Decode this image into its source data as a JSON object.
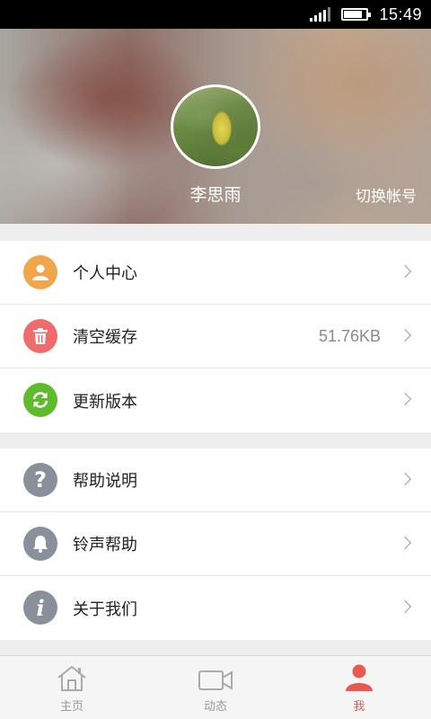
{
  "status_bar": {
    "time": "15:49",
    "signal_icon": "signal-icon",
    "battery_icon": "battery-icon",
    "battery_level": 0.8
  },
  "header": {
    "user_name": "李思雨",
    "switch_account_label": "切换帐号",
    "avatar_icon": "avatar-photo"
  },
  "menu_group_1": [
    {
      "label": "个人中心",
      "icon": "person-icon",
      "color": "#f0a64a",
      "value": ""
    },
    {
      "label": "清空缓存",
      "icon": "trash-icon",
      "color": "#f06c6c",
      "value": "51.76KB"
    },
    {
      "label": "更新版本",
      "icon": "refresh-icon",
      "color": "#5dbb2c",
      "value": ""
    }
  ],
  "menu_group_2": [
    {
      "label": "帮助说明",
      "icon": "question-icon",
      "color": "#8a9099"
    },
    {
      "label": "铃声帮助",
      "icon": "bell-icon",
      "color": "#8a9099"
    },
    {
      "label": "关于我们",
      "icon": "info-icon",
      "color": "#8a9099"
    }
  ],
  "tabbar": {
    "tabs": [
      {
        "label": "主页",
        "icon": "home-icon",
        "active": false
      },
      {
        "label": "动态",
        "icon": "video-camera-icon",
        "active": false
      },
      {
        "label": "我",
        "icon": "person-icon",
        "active": true
      }
    ],
    "active_color": "#e85a4f",
    "inactive_color": "#999999"
  }
}
